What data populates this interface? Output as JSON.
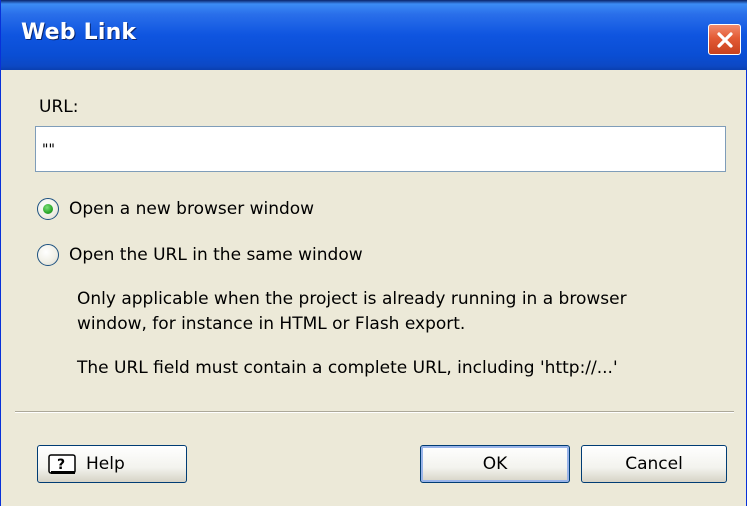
{
  "window": {
    "title": "Web Link"
  },
  "url": {
    "label": "URL:",
    "value": "\"\""
  },
  "options": {
    "new_window": {
      "label": "Open a new browser window",
      "checked": true
    },
    "same_window": {
      "label": "Open the URL in the same window",
      "checked": false
    }
  },
  "notes": {
    "line1": "Only applicable when the project is already running in a browser",
    "line2": "window, for instance in HTML or Flash export.",
    "line3": "The URL field must contain a complete URL, including 'http://...'"
  },
  "buttons": {
    "help": "Help",
    "ok": "OK",
    "cancel": "Cancel"
  },
  "icons": {
    "close": "close-icon",
    "help": "help-icon"
  },
  "colors": {
    "titlebar": "#0A4ED4",
    "close": "#E35B35",
    "dialog_bg": "#ECE9D8",
    "radio_dot": "#2BA82B"
  }
}
